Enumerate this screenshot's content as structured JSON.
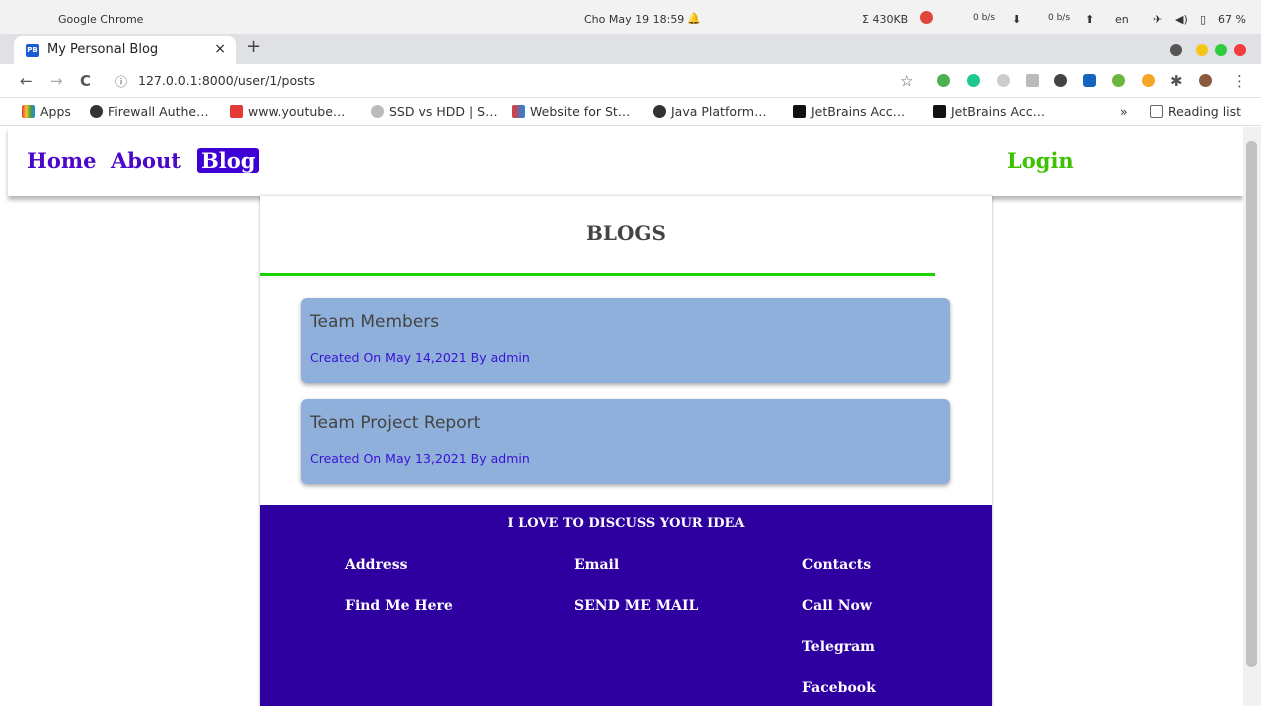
{
  "os": {
    "app_name": "Google Chrome",
    "datetime": "Cho May 19  18:59",
    "net_usage": "Σ 430KB",
    "down_speed": "0 b/s",
    "up_speed": "0 b/s",
    "language": "en",
    "battery": "67 %"
  },
  "browser": {
    "tab_title": "My Personal Blog",
    "tab_favicon": "PB",
    "url": "127.0.0.1:8000/user/1/posts",
    "bookmarks": [
      "Apps",
      "Firewall Authe…",
      "www.youtube…",
      "SSD vs HDD | S…",
      "Website for St…",
      "Java Platform…",
      "JetBrains Acc…",
      "JetBrains Acc…"
    ],
    "reading_list": "Reading list"
  },
  "nav": {
    "home": "Home",
    "about": "About",
    "blog": "Blog",
    "login": "Login"
  },
  "blogs": {
    "title": "BLOGS",
    "posts": [
      {
        "title": "Team Members",
        "meta": "Created On May 14,2021 By admin"
      },
      {
        "title": "Team Project Report",
        "meta": "Created On May 13,2021 By admin"
      }
    ]
  },
  "footer": {
    "heading": "I LOVE TO DISCUSS YOUR IDEA",
    "address_label": "Address",
    "address_value": "Find Me Here",
    "email_label": "Email",
    "email_value": "SEND ME MAIL",
    "contacts_label": "Contacts",
    "contacts_items": [
      "Call Now",
      "Telegram",
      "Facebook"
    ]
  },
  "colors": {
    "nav_link": "#4b08c9",
    "nav_active": "#3f00d6",
    "login": "#3ec100",
    "card": "#8fb0da",
    "footer": "#2e00a0",
    "divider": "#17d400"
  }
}
